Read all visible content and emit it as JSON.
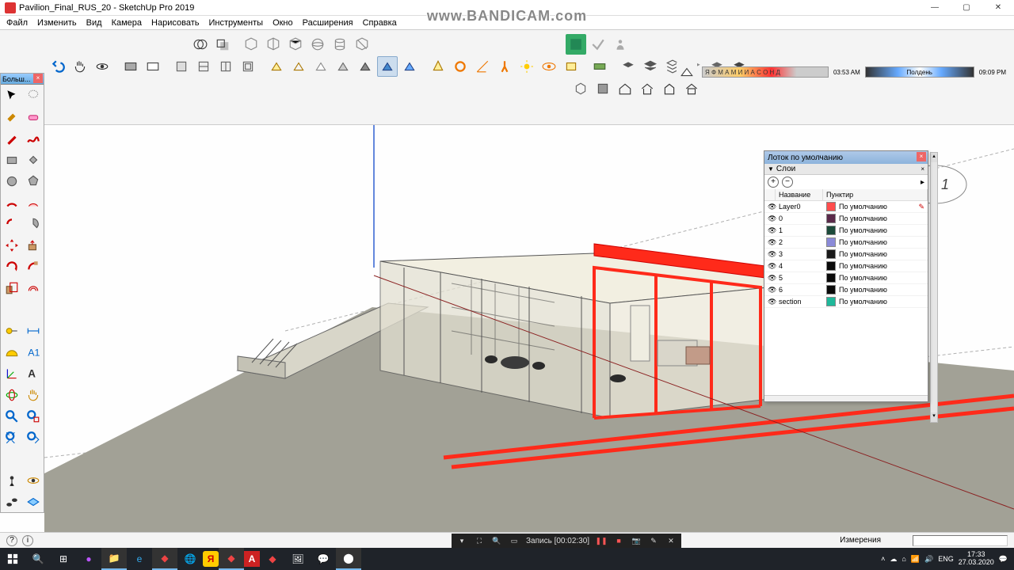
{
  "title": "Pavilion_Final_RUS_20 - SketchUp Pro 2019",
  "watermark": "www.BANDICAM.com",
  "menu": [
    "Файл",
    "Изменить",
    "Вид",
    "Камера",
    "Нарисовать",
    "Инструменты",
    "Окно",
    "Расширения",
    "Справка"
  ],
  "toolbox_title": "Больш...",
  "shadow": {
    "months": "Я Ф М А М И И А С О Н Д",
    "t1": "03:53 AM",
    "noon": "Полдень",
    "t2": "09:09 PM"
  },
  "layers": {
    "panel_title": "Лоток по умолчанию",
    "section": "Слои",
    "col_name": "Название",
    "col_dash": "Пунктир",
    "default_dash": "По умолчанию",
    "rows": [
      {
        "name": "Layer0",
        "color": "#ff4d4d"
      },
      {
        "name": "0",
        "color": "#5a2a4a"
      },
      {
        "name": "1",
        "color": "#1c4a3a"
      },
      {
        "name": "2",
        "color": "#8a8ad8"
      },
      {
        "name": "3",
        "color": "#1a1a1a"
      },
      {
        "name": "4",
        "color": "#0a0a0a"
      },
      {
        "name": "5",
        "color": "#0a0a0a"
      },
      {
        "name": "6",
        "color": "#0a0a0a"
      },
      {
        "name": "section",
        "color": "#1fb89a"
      }
    ]
  },
  "status": {
    "measurements": "Измерения"
  },
  "rec": {
    "label": "Запись [00:02:30]"
  },
  "tray": {
    "lang": "ENG",
    "time": "17:33",
    "date": "27.03.2020"
  }
}
